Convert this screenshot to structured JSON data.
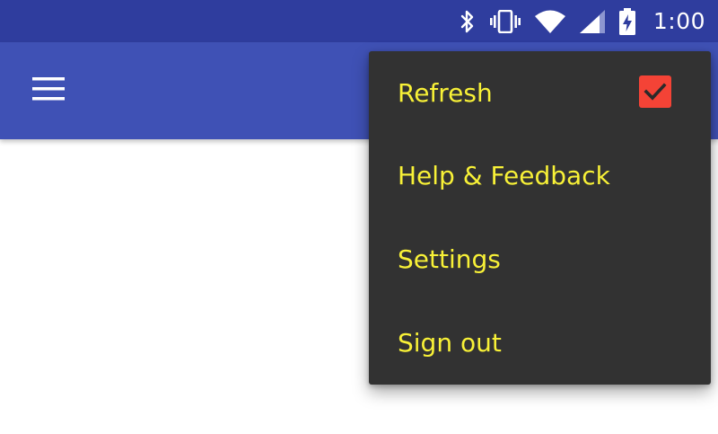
{
  "status_bar": {
    "time": "1:00",
    "icons": [
      "bluetooth-icon",
      "vibrate-icon",
      "wifi-icon",
      "signal-icon",
      "battery-charging-icon"
    ],
    "background": "#2f3d9e"
  },
  "app_bar": {
    "background": "#3f51b5",
    "menu_icon": "hamburger-menu-icon"
  },
  "overflow_menu": {
    "background": "#323232",
    "text_color": "#f8f137",
    "items": [
      {
        "label": "Refresh",
        "checked": true
      },
      {
        "label": "Help & Feedback"
      },
      {
        "label": "Settings"
      },
      {
        "label": "Sign out"
      }
    ],
    "checkbox_color": "#f44336"
  }
}
